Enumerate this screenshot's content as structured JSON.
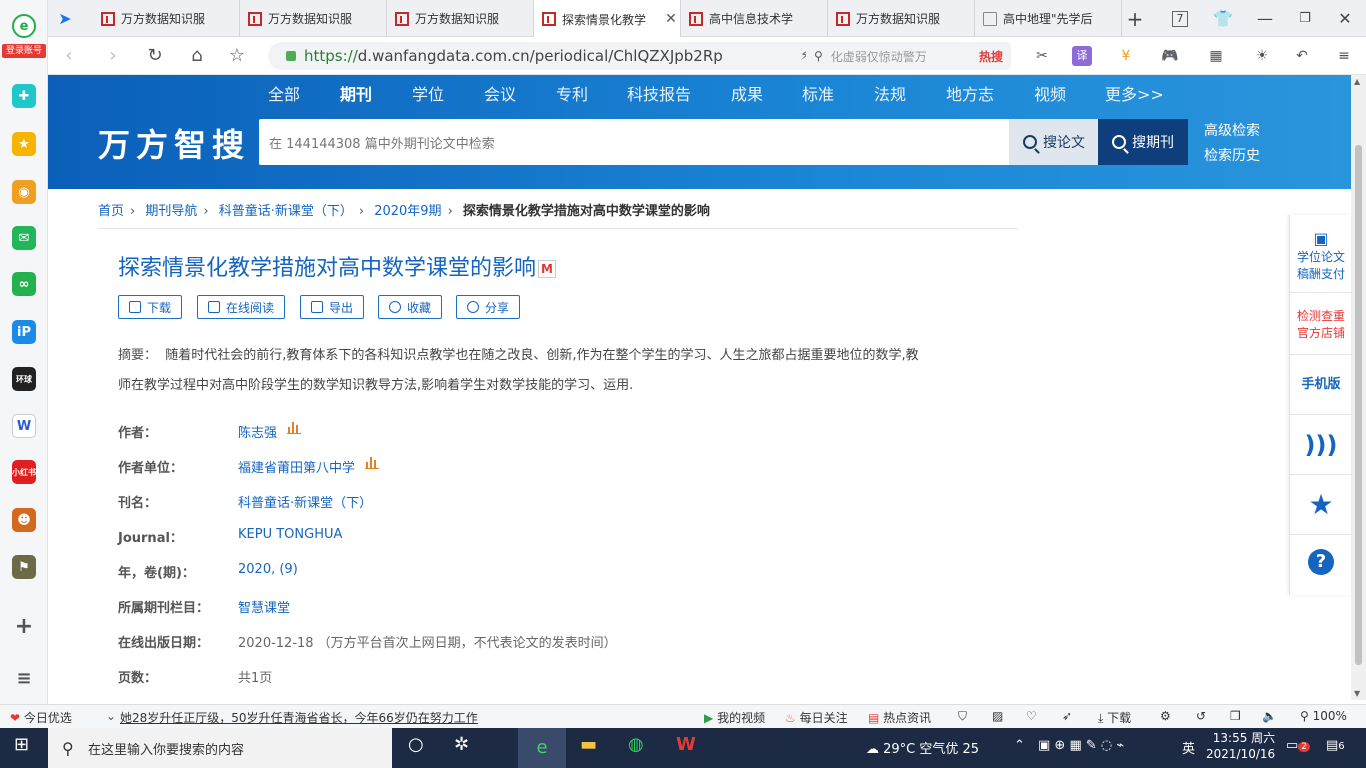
{
  "sidebar": {
    "login_label": "登录账号",
    "add": "+",
    "menu": "≡"
  },
  "tabs": [
    {
      "label": "万方数据知识服"
    },
    {
      "label": "万方数据知识服"
    },
    {
      "label": "万方数据知识服"
    },
    {
      "label": "探索情景化教学",
      "active": true
    },
    {
      "label": "高中信息技术学"
    },
    {
      "label": "万方数据知识服"
    },
    {
      "label": "高中地理\"先学后"
    }
  ],
  "tabbar": {
    "badge": "7"
  },
  "address": {
    "https": "https://",
    "rest": "d.wanfangdata.com.cn/periodical/ChlQZXJpb2Rp"
  },
  "searchbox": {
    "placeholder": "化虚弱仅惊动警万",
    "hot": "热搜"
  },
  "site": {
    "nav": [
      "全部",
      "期刊",
      "学位",
      "会议",
      "专利",
      "科技报告",
      "成果",
      "标准",
      "法规",
      "地方志",
      "视频",
      "更多>>"
    ],
    "logo": "万方智搜",
    "search_placeholder": "在 144144308 篇中外期刊论文中检索",
    "btn_paper": "搜论文",
    "btn_journal": "搜期刊",
    "advanced": "高级检索",
    "history": "检索历史"
  },
  "breadcrumb": [
    "首页",
    "期刊导航",
    "科普童话·新课堂（下）",
    "2020年9期",
    "探索情景化教学措施对高中数学课堂的影响"
  ],
  "article": {
    "title": "探索情景化教学措施对高中数学课堂的影响",
    "title_badge": "M",
    "actions": [
      "下载",
      "在线阅读",
      "导出",
      "收藏",
      "分享"
    ],
    "abstract_label": "摘要：",
    "abstract_line1": "随着时代社会的前行,教育体系下的各科知识点教学也在随之改良、创新,作为在整个学生的学习、人生之旅都占据重要地位的数学,教",
    "abstract_line2": "师在教学过程中对高中阶段学生的数学知识教导方法,影响着学生对数学技能的学习、运用.",
    "fields": [
      {
        "label": "作者：",
        "value": "陈志强"
      },
      {
        "label": "作者单位：",
        "value": "福建省莆田第八中学"
      },
      {
        "label": "刊名：",
        "value": "科普童话·新课堂（下）"
      },
      {
        "label": "Journal：",
        "value": "KEPU TONGHUA"
      },
      {
        "label": "年，卷(期)：",
        "value": "2020, (9)"
      },
      {
        "label": "所属期刊栏目：",
        "value": "智慧课堂"
      },
      {
        "label": "在线出版日期：",
        "value": "2020-12-18 （万方平台首次上网日期，不代表论文的发表时间）"
      },
      {
        "label": "页数：",
        "value": "共1页"
      }
    ]
  },
  "right_panel": {
    "thesis1": "学位论文",
    "thesis2": "稿酬支付",
    "check1": "检测查重",
    "check2": "官方店铺",
    "mobile": "手机版"
  },
  "statusbar": {
    "today": "今日优选",
    "news": "她28岁升任正厅级，50岁升任青海省省长，今年66岁仍在努力工作",
    "video": "我的视频",
    "daily": "每日关注",
    "hot": "热点资讯",
    "download": "下载",
    "zoom": "100%"
  },
  "taskbar": {
    "search": "在这里输入你要搜索的内容",
    "weather": "29°C  空气优 25",
    "lang": "英",
    "time": "13:55 周六",
    "date": "2021/10/16",
    "notif": "6",
    "badge": "2"
  }
}
